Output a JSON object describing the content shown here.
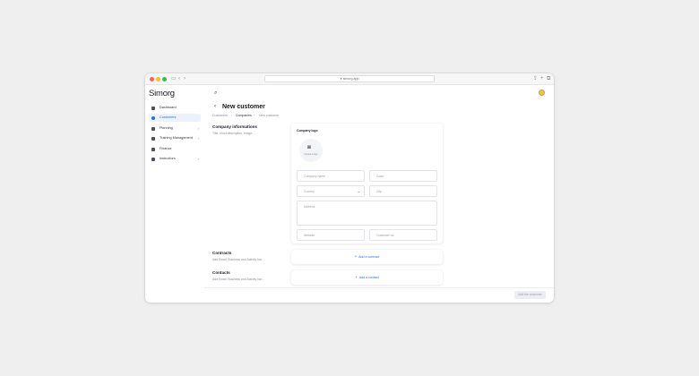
{
  "browser": {
    "url": "simorg.app",
    "colors": {
      "close": "#ff5f57",
      "minimize": "#febc2e",
      "maximize": "#28c840"
    }
  },
  "app": {
    "logo": "Simorg",
    "accent": "#2b6fdb"
  },
  "sidebar": {
    "items": [
      {
        "label": "Dashboard",
        "icon": "dashboard-icon",
        "active": false
      },
      {
        "label": "Customers",
        "icon": "customers-icon",
        "active": true
      },
      {
        "label": "Planning",
        "icon": "calendar-icon",
        "active": false,
        "expandable": true
      },
      {
        "label": "Training Management",
        "icon": "training-icon",
        "active": false,
        "expandable": true
      },
      {
        "label": "Finance",
        "icon": "finance-icon",
        "active": false
      },
      {
        "label": "Instructors",
        "icon": "instructors-icon",
        "active": false,
        "expandable": true
      }
    ]
  },
  "header": {
    "title": "New customer",
    "breadcrumb": [
      "Customers",
      "Companies",
      "New customer"
    ]
  },
  "company_info": {
    "title": "Company informations",
    "subtitle": "Title, short description, image...",
    "logo_label": "Company logo",
    "upload_label": "Upload a logo",
    "fields": {
      "company_name": "Company name",
      "code": "Code",
      "country": "Country",
      "city": "City",
      "address": "Address",
      "website": "Website",
      "customer_no": "Customer no."
    }
  },
  "contracts": {
    "title": "Contracts",
    "subtitle": "Add Email, Business and Activity bar...",
    "add_label": "Add a contract"
  },
  "contacts": {
    "title": "Contacts",
    "subtitle": "Add Email, Business and Activity bar...",
    "add_label": "Add a contact"
  },
  "footer": {
    "submit_label": "Add the customer"
  }
}
